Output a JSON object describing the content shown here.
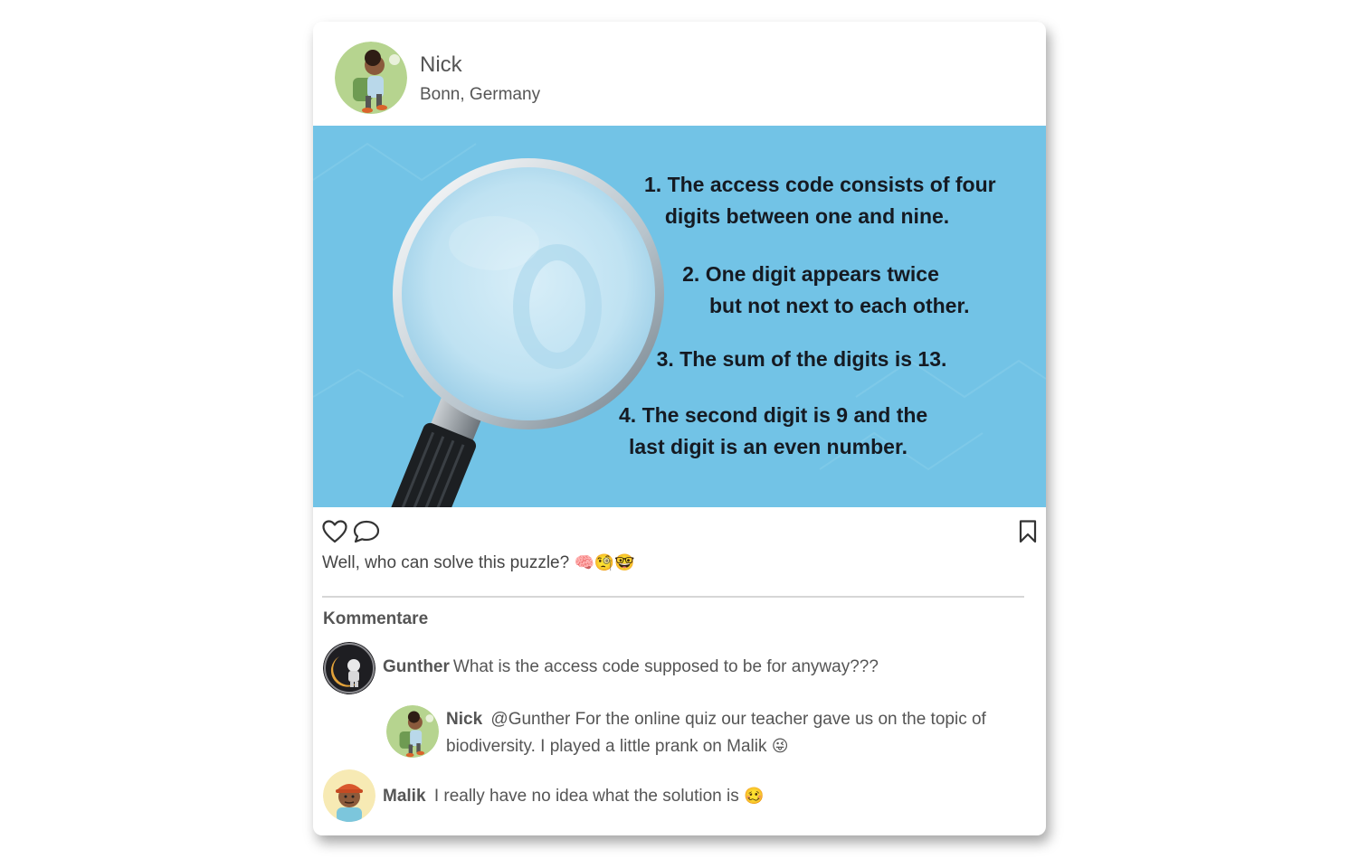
{
  "post": {
    "author_name": "Nick",
    "location": "Bonn, Germany",
    "caption": "Well, who can solve this puzzle?",
    "caption_emojis": "🧠🧐🤓"
  },
  "image": {
    "clues": {
      "c1_line1": "1. The access code consists of four",
      "c1_line2": "digits between one and nine.",
      "c2_line1": "2. One digit appears twice",
      "c2_line2": "but not next to each other.",
      "c3_line1": "3. The sum of the digits is 13.",
      "c4_line1": "4. The second digit is 9 and the",
      "c4_line2": "last digit is an even number."
    },
    "background_color": "#6fc4e6"
  },
  "actions": {
    "like_icon": "heart-icon",
    "comment_icon": "speech-bubble-icon",
    "bookmark_icon": "bookmark-icon"
  },
  "comments_section": {
    "title": "Kommentare",
    "items": [
      {
        "author": "Gunther",
        "text": "What is the access code supposed to be for anyway???",
        "emoji": ""
      },
      {
        "author": "Nick",
        "text": "@Gunther For the online quiz our teacher gave us on the topic of biodiversity. I played a little prank on Malik",
        "emoji": "😜"
      },
      {
        "author": "Malik",
        "text": "I really have no idea what the solution is",
        "emoji": "🥴"
      }
    ]
  }
}
